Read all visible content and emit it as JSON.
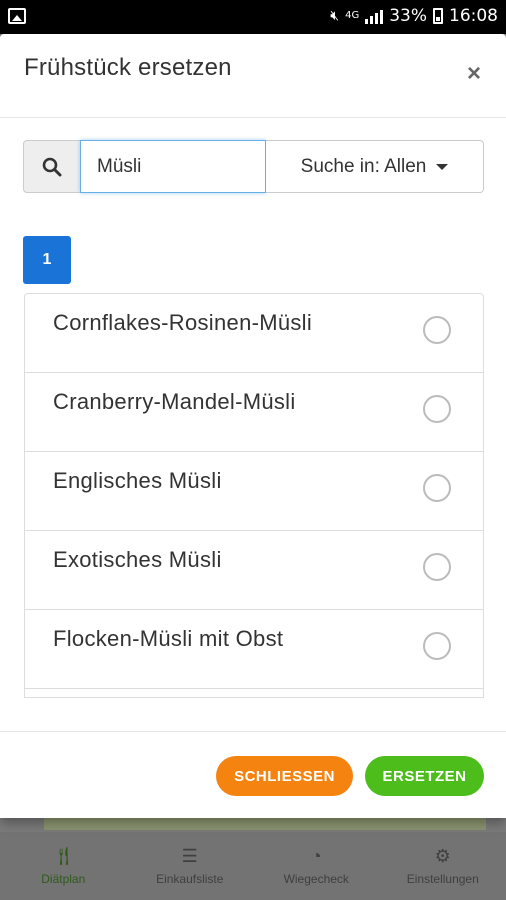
{
  "status_bar": {
    "battery_percent": "33%",
    "time": "16:08",
    "network": "4G"
  },
  "modal": {
    "title": "Frühstück ersetzen",
    "close_symbol": "×"
  },
  "search": {
    "value": "Müsli",
    "scope_label": "Suche in: Allen"
  },
  "pagination": {
    "current_page": "1"
  },
  "results": [
    {
      "label": "Cornflakes-Rosinen-Müsli"
    },
    {
      "label": "Cranberry-Mandel-Müsli"
    },
    {
      "label": "Englisches Müsli"
    },
    {
      "label": "Exotisches Müsli"
    },
    {
      "label": "Flocken-Müsli mit Obst"
    }
  ],
  "footer": {
    "close_label": "SCHLIESSEN",
    "replace_label": "ERSETZEN"
  },
  "bottom_nav": {
    "items": [
      {
        "label": "Diätplan",
        "icon": "cutlery-icon"
      },
      {
        "label": "Einkaufsliste",
        "icon": "list-icon"
      },
      {
        "label": "Wiegecheck",
        "icon": "gauge-icon"
      },
      {
        "label": "Einstellungen",
        "icon": "gear-icon"
      }
    ]
  },
  "colors": {
    "primary_blue": "#1a73d6",
    "orange": "#f5830f",
    "green": "#4dbd1c",
    "nav_active": "#2f5a1c"
  }
}
